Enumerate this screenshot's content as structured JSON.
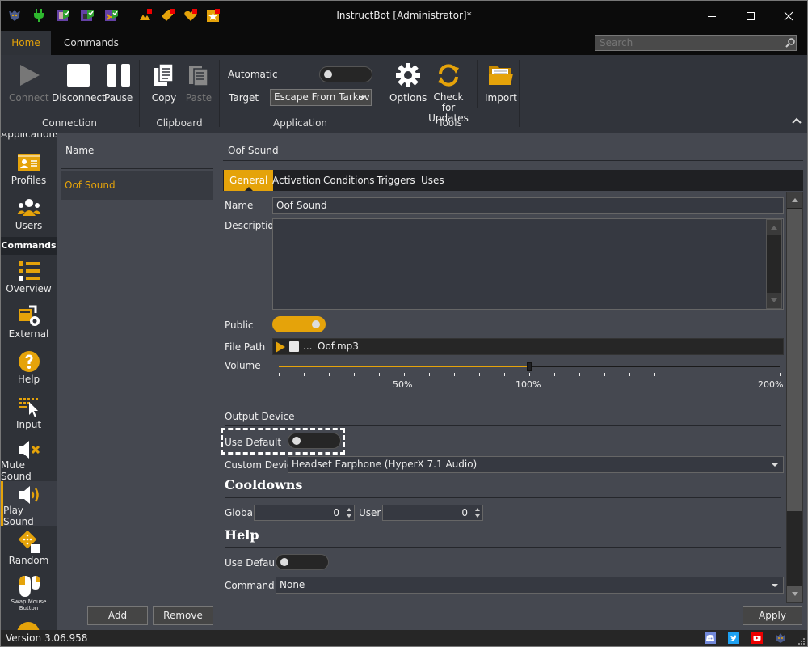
{
  "window": {
    "title": "InstructBot [Administrator]*",
    "quick_access_icons": [
      "app-logo-icon",
      "plug-icon",
      "twitch-user-icon",
      "twitch-bot-icon",
      "twitch-stream-icon",
      "bits-icon",
      "tag-icon",
      "heart-icon",
      "star-icon"
    ],
    "controls": {
      "minimize": "minimize-icon",
      "maximize": "maximize-icon",
      "close": "close-icon"
    }
  },
  "ribbon_tabs": [
    {
      "label": "Home",
      "active": true
    },
    {
      "label": "Commands",
      "active": false
    }
  ],
  "search": {
    "placeholder": "Search",
    "value": ""
  },
  "ribbon": {
    "groups": [
      {
        "label": "Connection",
        "buttons": [
          {
            "label": "Connect",
            "icon": "play-icon",
            "enabled": false
          },
          {
            "label": "Disconnect",
            "icon": "stop-icon",
            "enabled": true
          },
          {
            "label": "Pause",
            "icon": "pause-icon",
            "enabled": true
          }
        ]
      },
      {
        "label": "Clipboard",
        "buttons": [
          {
            "label": "Copy",
            "icon": "copy-icon",
            "enabled": true
          },
          {
            "label": "Paste",
            "icon": "paste-icon",
            "enabled": false
          }
        ]
      },
      {
        "label": "Application"
      },
      {
        "label": "Tools",
        "buttons": [
          {
            "label": "Options",
            "icon": "gear-icon",
            "enabled": true
          },
          {
            "label": "Check for Updates",
            "icon": "refresh-icon",
            "enabled": true
          }
        ]
      },
      {
        "label": "",
        "buttons": [
          {
            "label": "Import",
            "icon": "folder-icon",
            "enabled": true
          }
        ]
      }
    ],
    "application": {
      "automatic_label": "Automatic",
      "automatic_on": false,
      "target_label": "Target",
      "target_value": "Escape From Tarkov"
    }
  },
  "nav": {
    "partial_top_label": "Applications",
    "items": [
      {
        "label": "Profiles",
        "icon": "profile-card-icon"
      },
      {
        "label": "Users",
        "icon": "users-icon"
      }
    ],
    "section_header": "Commands",
    "command_items": [
      {
        "label": "Overview",
        "icon": "list-overview-icon"
      },
      {
        "label": "External",
        "icon": "external-gear-icon"
      },
      {
        "label": "Help",
        "icon": "help-icon"
      },
      {
        "label": "Input",
        "icon": "keyboard-cursor-icon"
      },
      {
        "label": "Mute Sound",
        "icon": "mute-icon"
      },
      {
        "label": "Play Sound",
        "icon": "speaker-icon",
        "active": true
      },
      {
        "label": "Random",
        "icon": "dice-icon"
      },
      {
        "label": "Swap Mouse Button",
        "icon": "mouse-icon"
      }
    ]
  },
  "list": {
    "header": "Name",
    "rows": [
      "Oof Sound"
    ],
    "add_label": "Add",
    "remove_label": "Remove"
  },
  "detail": {
    "title": "Oof Sound",
    "tabs": [
      {
        "label": "General",
        "active": true
      },
      {
        "label": "Activation"
      },
      {
        "label": "Conditions"
      },
      {
        "label": "Triggers"
      },
      {
        "label": "Uses"
      }
    ],
    "name_label": "Name",
    "name_value": "Oof Sound",
    "description_label": "Description",
    "description_value": "",
    "public_label": "Public",
    "public_on": true,
    "file_path_label": "File Path",
    "file_path_ellipsis": "...",
    "file_path_value": "Oof.mp3",
    "volume_label": "Volume",
    "volume_percent": 100,
    "volume_max_percent": 200,
    "volume_tick_labels": [
      "50%",
      "100%",
      "200%"
    ],
    "output_device_header": "Output Device",
    "use_default_label": "Use Default",
    "use_default_on": false,
    "custom_device_label": "Custom Device",
    "custom_device_value": "Headset Earphone (HyperX 7.1 Audio)",
    "cooldowns_title": "Cooldowns",
    "global_label": "Global",
    "global_value": "0",
    "user_label": "User",
    "user_value": "0",
    "help_title": "Help",
    "help_use_default_label": "Use Default",
    "help_use_default_on": false,
    "command_label": "Command",
    "command_value": "None",
    "apply_label": "Apply"
  },
  "status": {
    "version": "Version 3.06.958",
    "social_icons": [
      "discord-icon",
      "twitter-icon",
      "youtube-icon",
      "app-logo-icon"
    ]
  },
  "colors": {
    "accent": "#e5a30a",
    "background": "#454850",
    "titlebar": "#0b0b0b"
  }
}
